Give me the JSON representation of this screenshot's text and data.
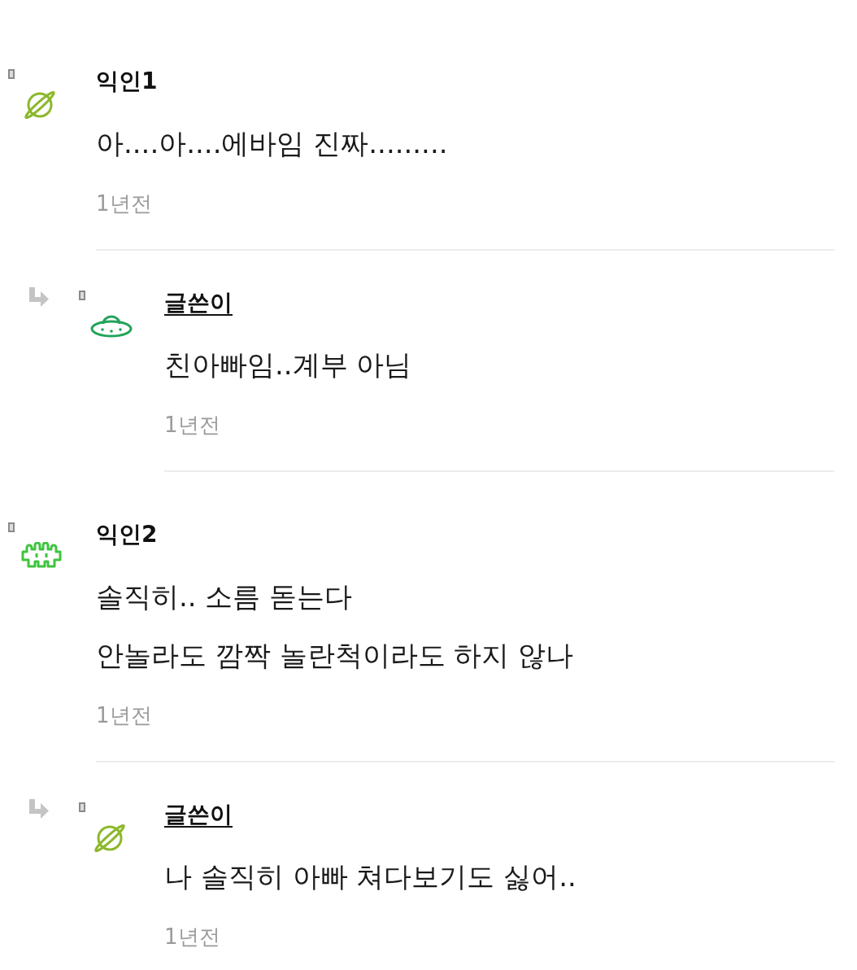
{
  "comments": [
    {
      "kind": "comment",
      "author": "익인1",
      "is_author": false,
      "avatar": {
        "kind": "planet",
        "color": "#8cb82b"
      },
      "lines": [
        "아....아....에바임 진짜........."
      ],
      "time": "1년전"
    },
    {
      "kind": "reply",
      "author": "글쓴이",
      "is_author": true,
      "avatar": {
        "kind": "ufo",
        "color": "#23a35a"
      },
      "lines": [
        "친아빠임..계부 아님"
      ],
      "time": "1년전"
    },
    {
      "kind": "comment",
      "author": "익인2",
      "is_author": false,
      "avatar": {
        "kind": "invader",
        "color": "#3ec43e"
      },
      "lines": [
        "솔직히.. 소름 돋는다",
        "안놀라도 깜짝 놀란척이라도 하지 않나"
      ],
      "time": "1년전"
    },
    {
      "kind": "reply",
      "author": "글쓴이",
      "is_author": true,
      "avatar": {
        "kind": "planet",
        "color": "#8cb82b"
      },
      "lines": [
        "나 솔직히 아빠 쳐다보기도 싫어.."
      ],
      "time": "1년전"
    }
  ]
}
